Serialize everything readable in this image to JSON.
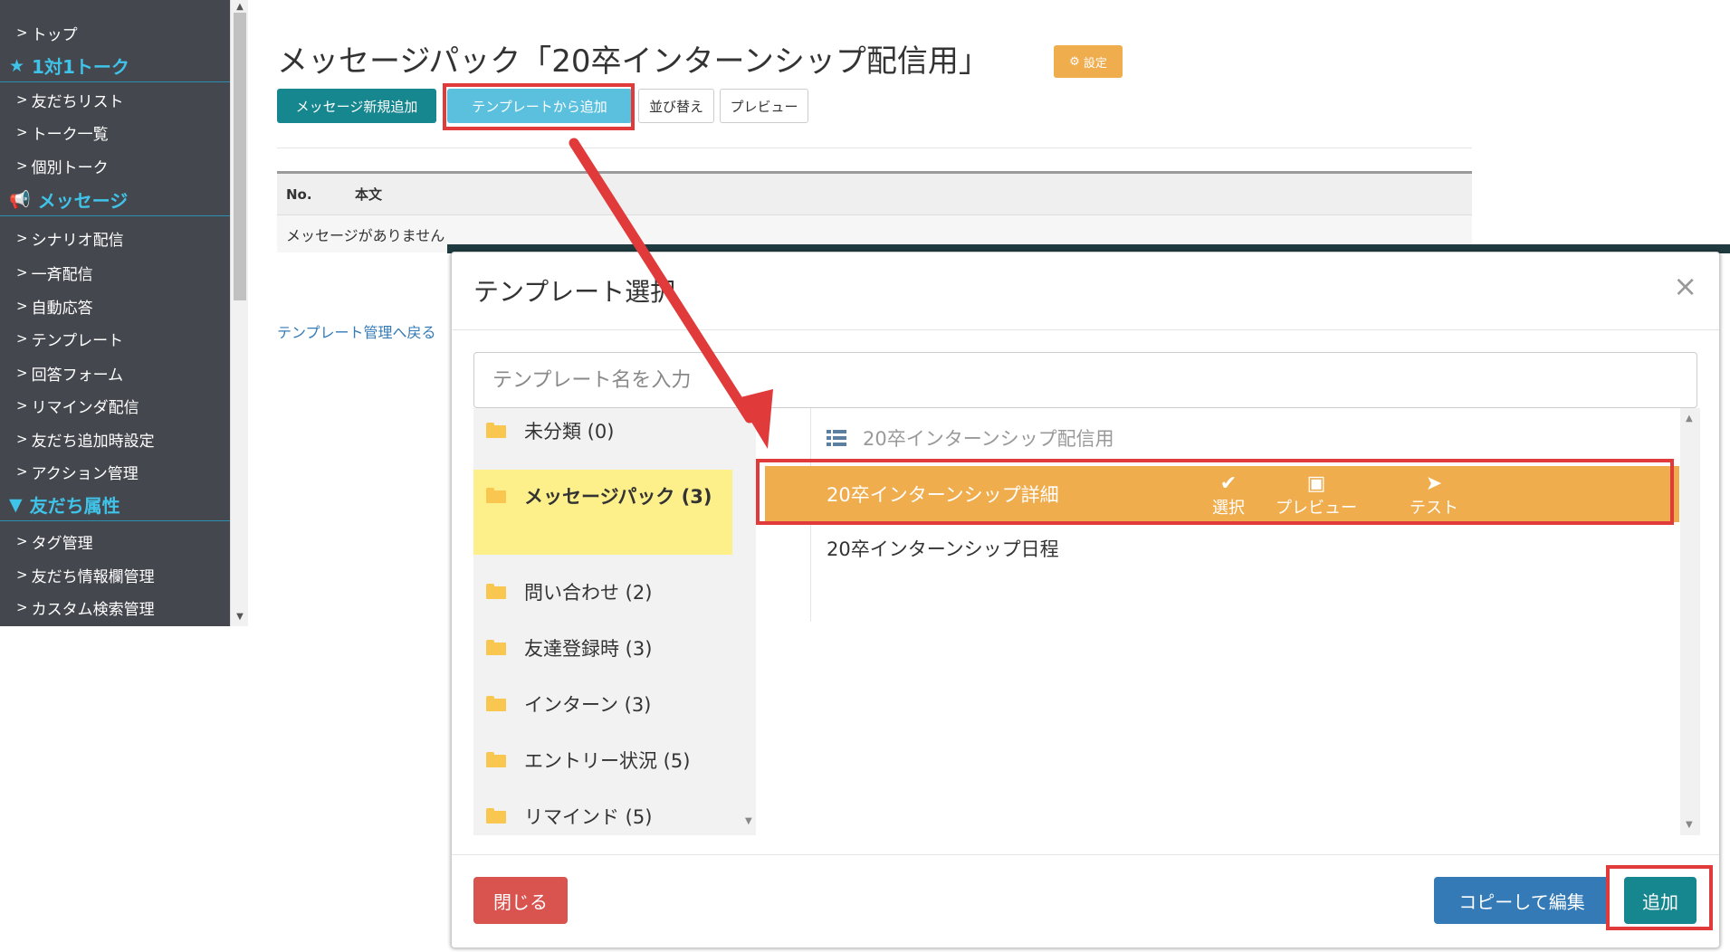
{
  "sidebar": {
    "items": [
      {
        "kind": "item",
        "label": "トップ"
      },
      {
        "kind": "category",
        "icon": "★",
        "label": "1対1トーク"
      },
      {
        "kind": "item",
        "label": "友だちリスト"
      },
      {
        "kind": "item",
        "label": "トーク一覧"
      },
      {
        "kind": "item",
        "label": "個別トーク"
      },
      {
        "kind": "category",
        "icon": "📢",
        "label": "メッセージ"
      },
      {
        "kind": "item",
        "label": "シナリオ配信"
      },
      {
        "kind": "item",
        "label": "一斉配信"
      },
      {
        "kind": "item",
        "label": "自動応答"
      },
      {
        "kind": "item",
        "label": "テンプレート"
      },
      {
        "kind": "item",
        "label": "回答フォーム"
      },
      {
        "kind": "item",
        "label": "リマインダ配信"
      },
      {
        "kind": "item",
        "label": "友だち追加時設定"
      },
      {
        "kind": "item",
        "label": "アクション管理"
      },
      {
        "kind": "category",
        "icon": "▼",
        "label": "友だち属性"
      },
      {
        "kind": "item",
        "label": "タグ管理"
      },
      {
        "kind": "item",
        "label": "友だち情報欄管理"
      },
      {
        "kind": "item",
        "label": "カスタム検索管理"
      }
    ]
  },
  "page": {
    "title": "メッセージパック「20卒インターンシップ配信用」",
    "settings_label": "設定",
    "back_link": "テンプレート管理へ戻る"
  },
  "toolbar": {
    "new_label": "メッセージ新規追加",
    "template_label": "テンプレートから追加",
    "sort_label": "並び替え",
    "preview_label": "プレビュー"
  },
  "table": {
    "columns": [
      "No.",
      "本文"
    ],
    "empty_text": "メッセージがありません"
  },
  "modal": {
    "title": "テンプレート選択",
    "search_placeholder": "テンプレート名を入力",
    "folders": [
      {
        "label": "未分類 (0)"
      },
      {
        "label": "メッセージパック (3)",
        "active": true
      },
      {
        "label": "問い合わせ (2)"
      },
      {
        "label": "友達登録時 (3)"
      },
      {
        "label": "インターン (3)"
      },
      {
        "label": "エントリー状況 (5)"
      },
      {
        "label": "リマインド (5)"
      }
    ],
    "group_title": "20卒インターンシップ配信用",
    "templates": [
      {
        "name": "20卒インターンシップ詳細",
        "selected": true
      },
      {
        "name": "20卒インターンシップ日程"
      }
    ],
    "actions": {
      "select": "選択",
      "preview": "プレビュー",
      "test": "テスト"
    },
    "close_label": "閉じる",
    "copy_label": "コピーして編集",
    "add_label": "追加"
  },
  "colors": {
    "sidebar_bg": "#45474f",
    "sidebar_accent": "#3fc3e8",
    "teal": "#16868f",
    "orange": "#f0ad4e",
    "highlight_red": "#e03a3a"
  }
}
